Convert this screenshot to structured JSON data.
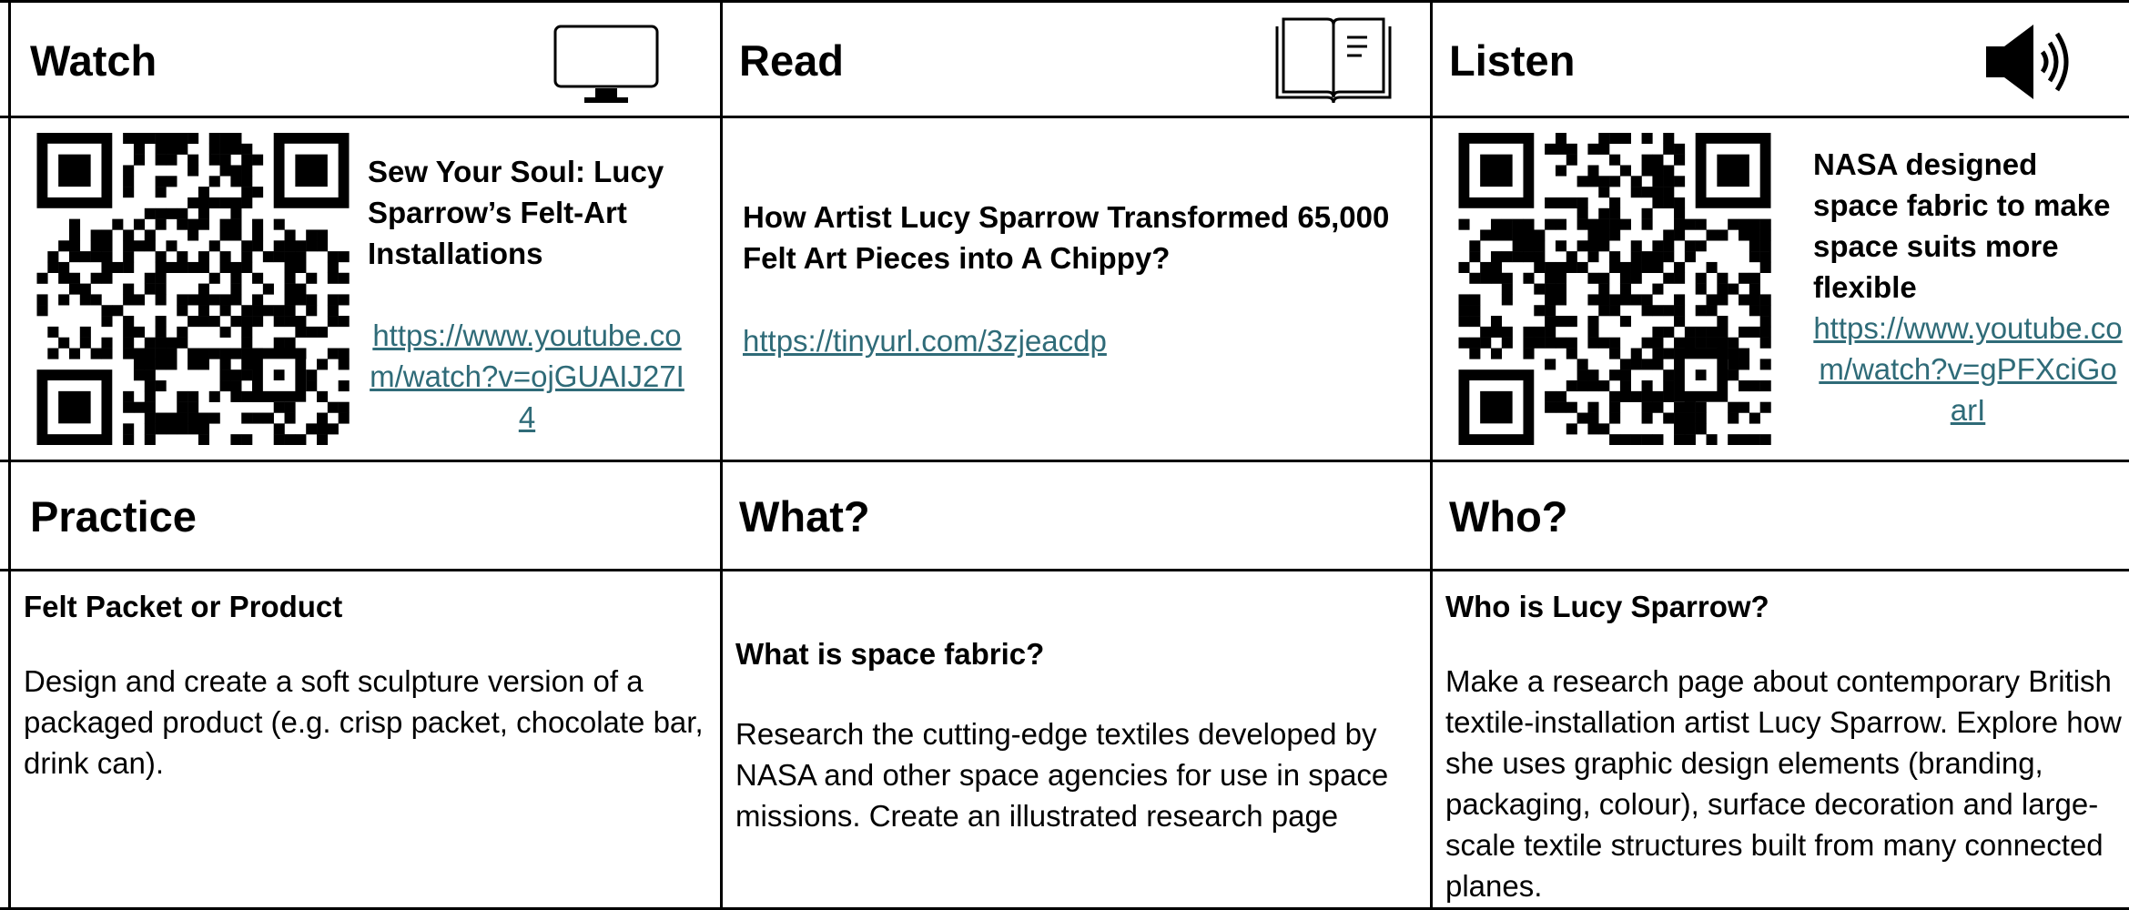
{
  "headers": {
    "watch": "Watch",
    "read": "Read",
    "listen": "Listen",
    "practice": "Practice",
    "what": "What?",
    "who": "Who?"
  },
  "icons": {
    "watch": "monitor-icon",
    "read": "book-icon",
    "listen": "speaker-icon"
  },
  "watch_cell": {
    "title": "Sew Your Soul: Lucy Sparrow’s Felt-Art Installations",
    "link": "https://www.youtube.com/watch?v=ojGUAIJ27I4"
  },
  "read_cell": {
    "title": "How Artist Lucy Sparrow Transformed 65,000 Felt Art Pieces into A Chippy?",
    "link": "https://tinyurl.com/3zjeacdp"
  },
  "listen_cell": {
    "title": "NASA designed space fabric to make space suits more flexible",
    "link": "https://www.youtube.com/watch?v=gPFXciGoarI"
  },
  "practice_cell": {
    "heading": "Felt Packet or Product",
    "body": "Design and create a soft sculpture version of a packaged product (e.g. crisp packet, chocolate bar, drink can)."
  },
  "what_cell": {
    "heading": "What is space fabric?",
    "body": "Research the cutting-edge textiles developed by NASA and other space agencies for use in space missions. Create an illustrated research page"
  },
  "who_cell": {
    "heading": "Who is Lucy Sparrow?",
    "body": "Make a research page about contemporary British textile-installation artist Lucy Sparrow. Explore how she uses graphic design elements (branding, packaging, colour), surface decoration and large-scale textile structures built from many connected planes."
  },
  "colors": {
    "link": "#2f6b78",
    "border": "#000000"
  }
}
